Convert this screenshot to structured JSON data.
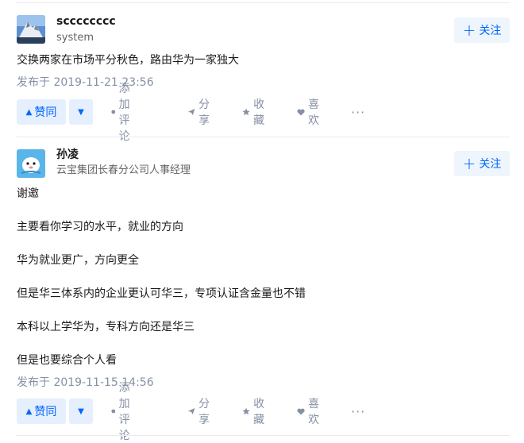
{
  "answers": [
    {
      "author": {
        "name": "scccccccc",
        "bio": "system"
      },
      "follow_label": "关注",
      "follow_plus": "+",
      "body": [
        "交换两家在市场平分秋色，路由华为一家独大"
      ],
      "published": "发布于 2019-11-21 23:56",
      "actions": {
        "upvote": "赞同",
        "upvote_symbol": "▲",
        "downvote_symbol": "▼",
        "comment": "添加评论",
        "share": "分享",
        "collect": "收藏",
        "like": "喜欢",
        "more": "···"
      }
    },
    {
      "author": {
        "name": "孙凌",
        "bio": "云宝集团长春分公司人事经理"
      },
      "follow_label": "关注",
      "follow_plus": "+",
      "body": [
        "谢邀",
        "主要看你学习的水平，就业的方向",
        "华为就业更广，方向更全",
        "但是华三体系内的企业更认可华三，专项认证含金量也不错",
        "本科以上学华为，专科方向还是华三",
        "但是也要综合个人看"
      ],
      "published": "发布于 2019-11-15 14:56",
      "actions": {
        "upvote": "赞同",
        "upvote_symbol": "▲",
        "downvote_symbol": "▼",
        "comment": "添加评论",
        "share": "分享",
        "collect": "收藏",
        "like": "喜欢",
        "more": "···"
      }
    }
  ],
  "colors": {
    "accent": "#0066ff",
    "vote_bg": "#e5effd",
    "meta": "#8590a6"
  }
}
